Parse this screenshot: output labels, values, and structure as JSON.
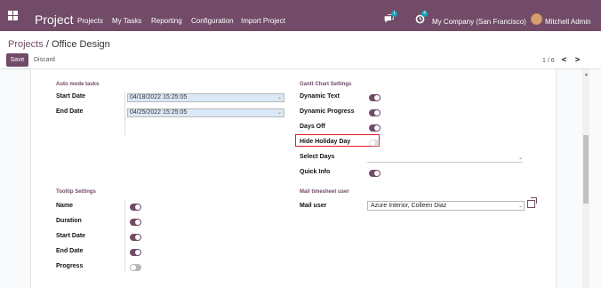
{
  "nav": {
    "brand": "Project",
    "items": [
      "Projects",
      "My Tasks",
      "Reporting",
      "Configuration",
      "Import Project"
    ],
    "badges": [
      "1",
      "4"
    ],
    "company": "My Company (San Francisco)",
    "user": "Mitchell Admin"
  },
  "breadcrumb": {
    "parent": "Projects",
    "separator": "/",
    "current": "Office Design"
  },
  "actions": {
    "save": "Save",
    "discard": "Discard",
    "pager": "1 / 6",
    "previous": "<",
    "next": ">"
  },
  "sections": {
    "auto_mode": "Auto mode tasks",
    "gantt": "Gantt Chart Settings",
    "tooltip": "Tooltip Settings",
    "mail": "Mail timesheet user"
  },
  "fields": {
    "start_date": {
      "label": "Start Date",
      "value": "04/18/2022 15:25:05"
    },
    "end_date": {
      "label": "End Date",
      "value": "04/25/2022 15:25:05"
    },
    "dynamic_text": "Dynamic Text",
    "dynamic_progress": "Dynamic Progress",
    "days_off": "Days Off",
    "hide_holiday_day": "Hide Holiday Day",
    "select_days": "Select Days",
    "quick_info": "Quick Info",
    "mail_user": {
      "label": "Mail user",
      "value": "Azure Interior, Colleen Diaz"
    },
    "tooltip": {
      "name": "Name",
      "duration": "Duration",
      "start_date": "Start Date",
      "end_date": "End Date",
      "progress": "Progress"
    }
  },
  "toggle_states": {
    "dynamic_text": true,
    "dynamic_progress": true,
    "days_off": true,
    "hide_holiday_day": false,
    "quick_info": true,
    "name": true,
    "duration": true,
    "start_date": true,
    "end_date": true,
    "progress": false
  },
  "colors": {
    "brand": "#714B67",
    "highlight": "#e41b2d",
    "toggle_off": "#b8b8b8"
  },
  "icons": {
    "apps": "apps-grid-icon",
    "chat": "chat-icon",
    "activity": "clock-icon",
    "external": "external-link-icon"
  }
}
